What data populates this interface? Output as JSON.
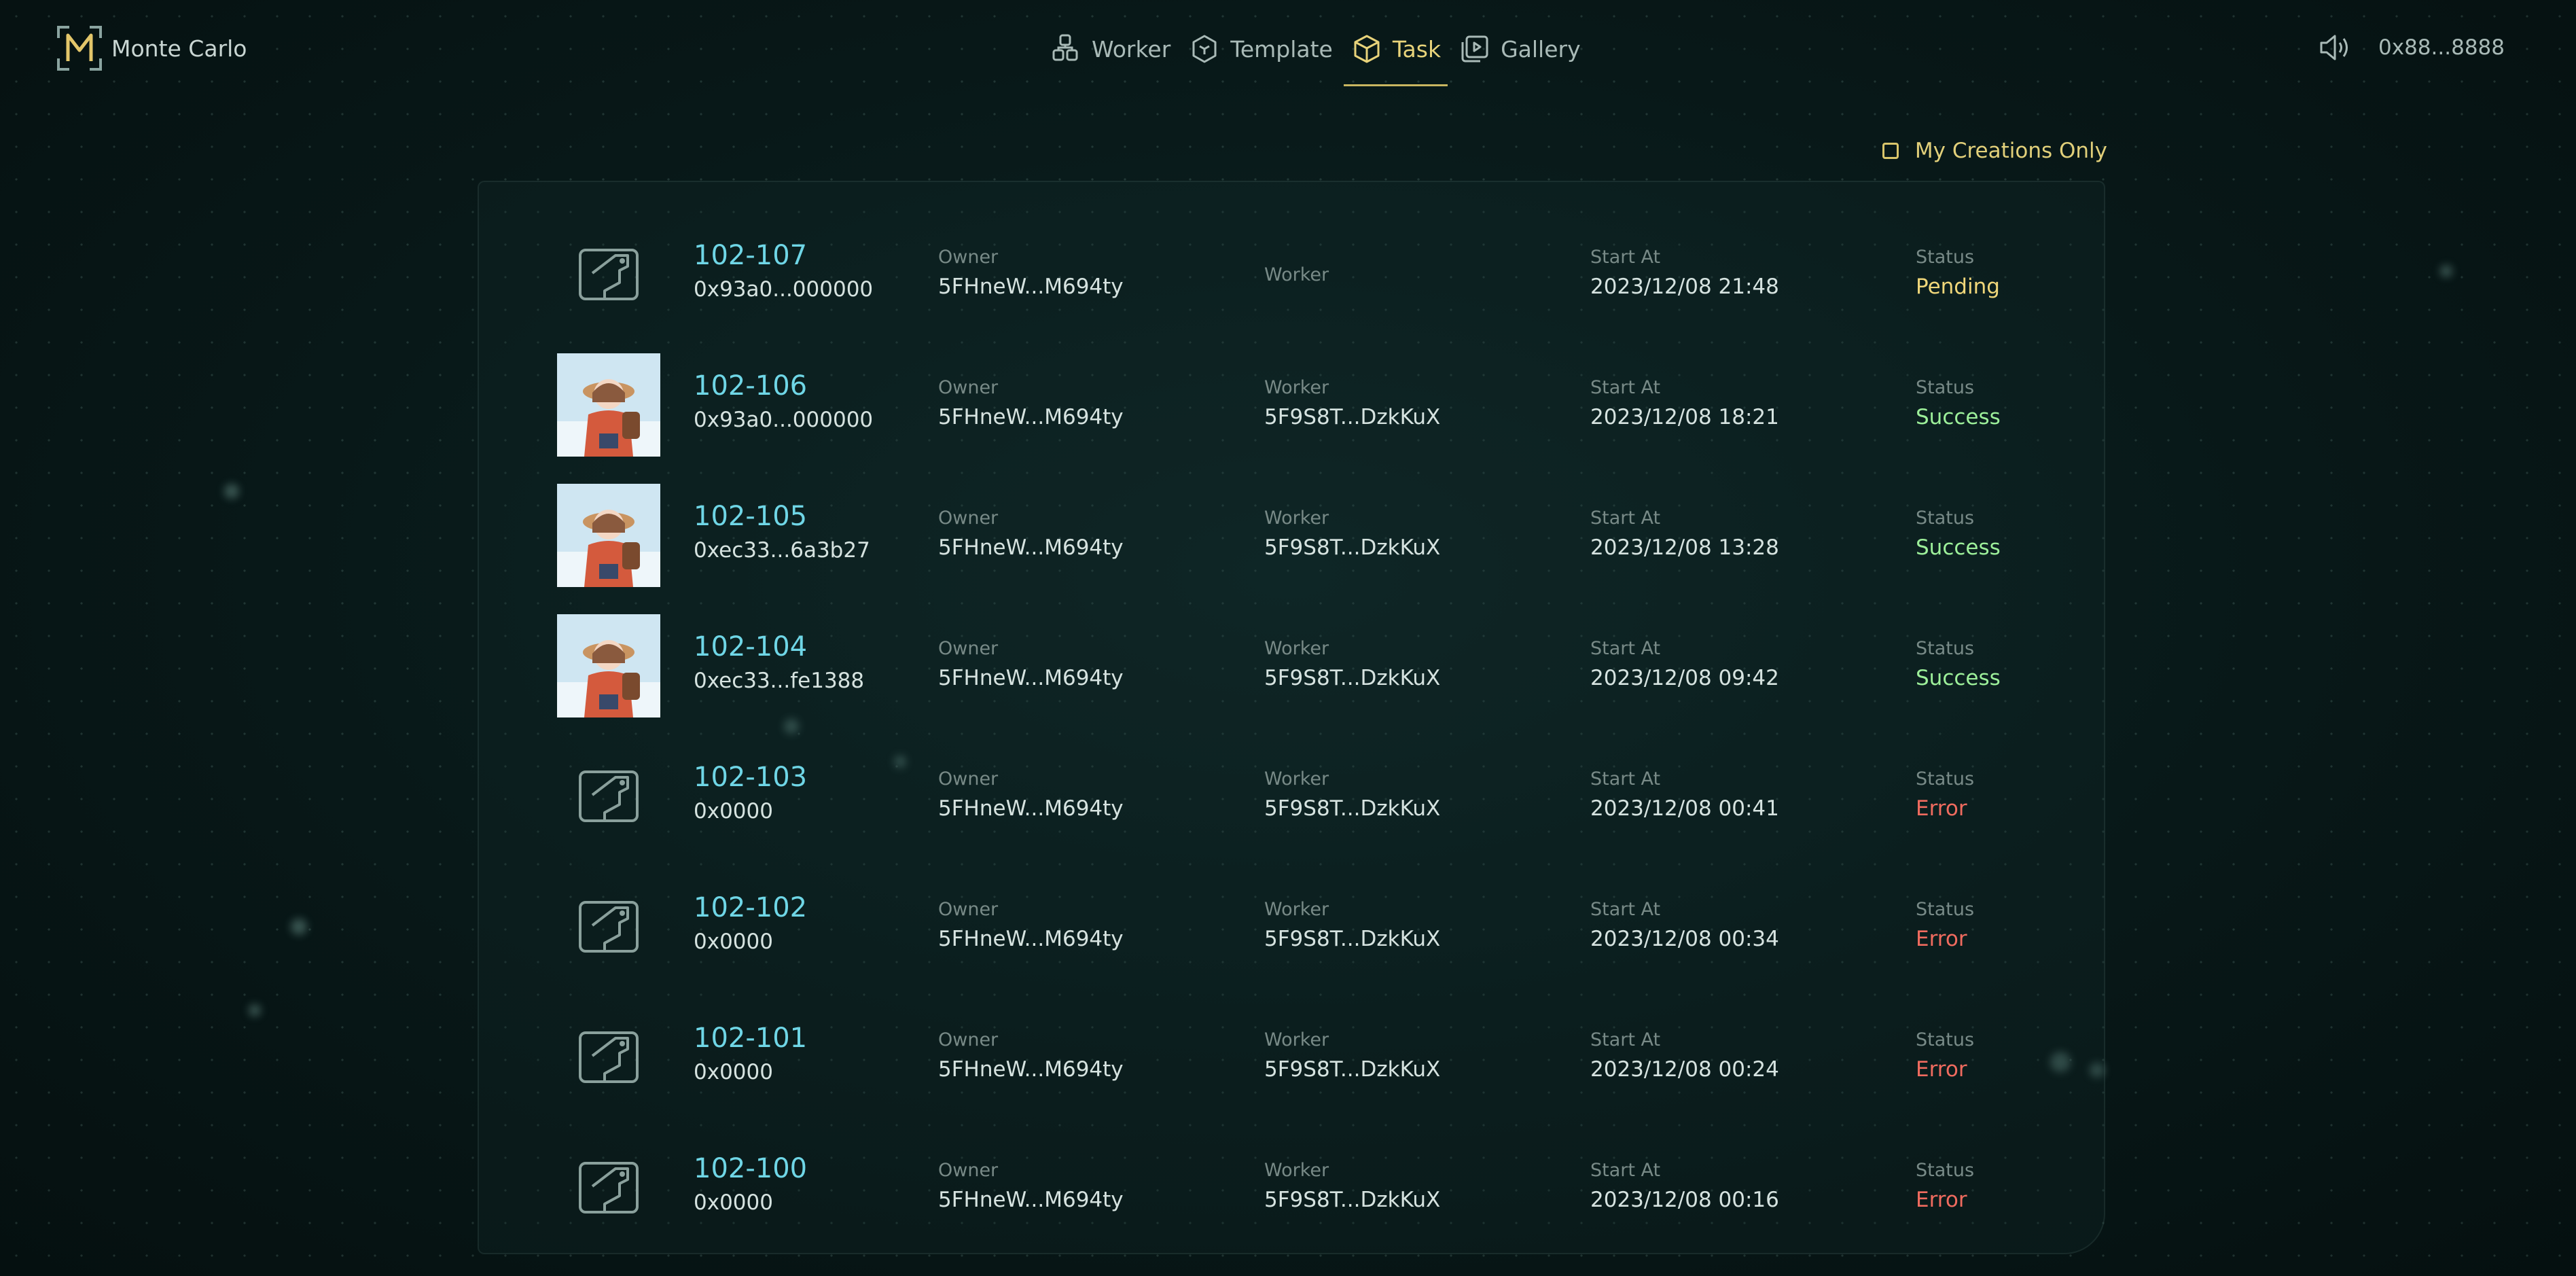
{
  "brand": {
    "name": "Monte Carlo",
    "logo_letter": "M"
  },
  "nav": {
    "items": [
      {
        "label": "Worker",
        "icon": "worker-icon"
      },
      {
        "label": "Template",
        "icon": "template-icon"
      },
      {
        "label": "Task",
        "icon": "task-icon",
        "active": true
      },
      {
        "label": "Gallery",
        "icon": "gallery-icon"
      }
    ]
  },
  "header_right": {
    "sound_icon": "speaker-icon",
    "wallet": "0x88...8888"
  },
  "filter": {
    "label": "My Creations Only",
    "checked": false
  },
  "table": {
    "labels": {
      "owner": "Owner",
      "worker": "Worker",
      "start": "Start At",
      "status": "Status"
    },
    "rows": [
      {
        "id": "102-107",
        "hash": "0x93a0...000000",
        "owner": "5FHneW...M694ty",
        "worker": "",
        "start": "2023/12/08 21:48",
        "status": "Pending",
        "thumb": "placeholder"
      },
      {
        "id": "102-106",
        "hash": "0x93a0...000000",
        "owner": "5FHneW...M694ty",
        "worker": "5F9S8T...DzkKuX",
        "start": "2023/12/08 18:21",
        "status": "Success",
        "thumb": "image"
      },
      {
        "id": "102-105",
        "hash": "0xec33...6a3b27",
        "owner": "5FHneW...M694ty",
        "worker": "5F9S8T...DzkKuX",
        "start": "2023/12/08 13:28",
        "status": "Success",
        "thumb": "image"
      },
      {
        "id": "102-104",
        "hash": "0xec33...fe1388",
        "owner": "5FHneW...M694ty",
        "worker": "5F9S8T...DzkKuX",
        "start": "2023/12/08 09:42",
        "status": "Success",
        "thumb": "image"
      },
      {
        "id": "102-103",
        "hash": "0x0000",
        "owner": "5FHneW...M694ty",
        "worker": "5F9S8T...DzkKuX",
        "start": "2023/12/08 00:41",
        "status": "Error",
        "thumb": "placeholder"
      },
      {
        "id": "102-102",
        "hash": "0x0000",
        "owner": "5FHneW...M694ty",
        "worker": "5F9S8T...DzkKuX",
        "start": "2023/12/08 00:34",
        "status": "Error",
        "thumb": "placeholder"
      },
      {
        "id": "102-101",
        "hash": "0x0000",
        "owner": "5FHneW...M694ty",
        "worker": "5F9S8T...DzkKuX",
        "start": "2023/12/08 00:24",
        "status": "Error",
        "thumb": "placeholder"
      },
      {
        "id": "102-100",
        "hash": "0x0000",
        "owner": "5FHneW...M694ty",
        "worker": "5F9S8T...DzkKuX",
        "start": "2023/12/08 00:16",
        "status": "Error",
        "thumb": "placeholder"
      }
    ]
  },
  "colors": {
    "accent": "#e8d37a",
    "id_text": "#6fd6e6",
    "pending": "#f0d77a",
    "success": "#9df09a",
    "error": "#f06b5f"
  }
}
